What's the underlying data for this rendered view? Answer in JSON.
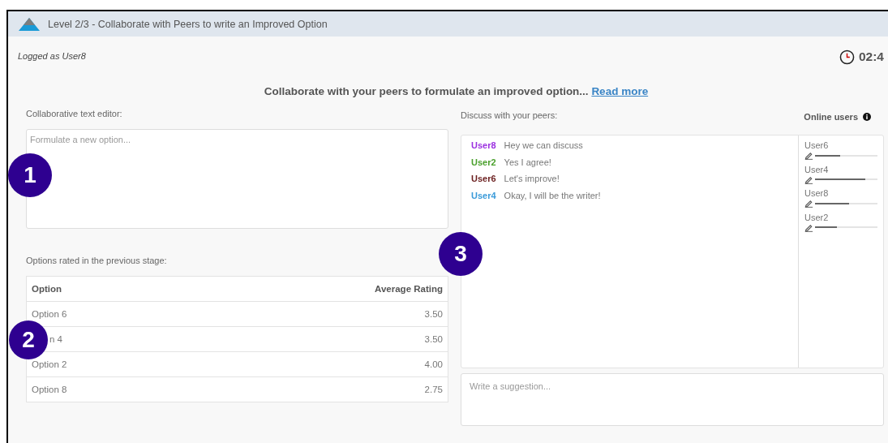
{
  "window": {
    "title": "Level 2/3 - Collaborate with Peers to write an Improved Option"
  },
  "logged_as": "Logged as User8",
  "timer": "02:4",
  "instruction": {
    "text": "Collaborate with your peers to formulate an improved option...",
    "link": "Read more"
  },
  "editor": {
    "label": "Collaborative text editor:",
    "placeholder": "Formulate a new option..."
  },
  "ratings": {
    "label": "Options rated in the previous stage:",
    "columns": [
      "Option",
      "Average Rating"
    ],
    "rows": [
      [
        "Option 6",
        "3.50"
      ],
      [
        "n 4",
        "3.50"
      ],
      [
        "Option 2",
        "4.00"
      ],
      [
        "Option 8",
        "2.75"
      ]
    ]
  },
  "chat": {
    "label": "Discuss with your peers:",
    "messages": [
      {
        "user": "User8",
        "color": "#9b30e0",
        "text": "Hey we can discuss"
      },
      {
        "user": "User2",
        "color": "#4aa02c",
        "text": "Yes I agree!"
      },
      {
        "user": "User6",
        "color": "#6b1f1f",
        "text": "Let's improve!"
      },
      {
        "user": "User4",
        "color": "#3a9ad9",
        "text": "Okay, I will be the writer!"
      }
    ],
    "suggestion_placeholder": "Write a suggestion..."
  },
  "online_users": {
    "title": "Online users",
    "users": [
      {
        "name": "User6",
        "level": 0.4
      },
      {
        "name": "User4",
        "level": 0.8
      },
      {
        "name": "User8",
        "level": 0.55
      },
      {
        "name": "User2",
        "level": 0.35
      }
    ]
  },
  "callouts": [
    "1",
    "2",
    "3"
  ]
}
